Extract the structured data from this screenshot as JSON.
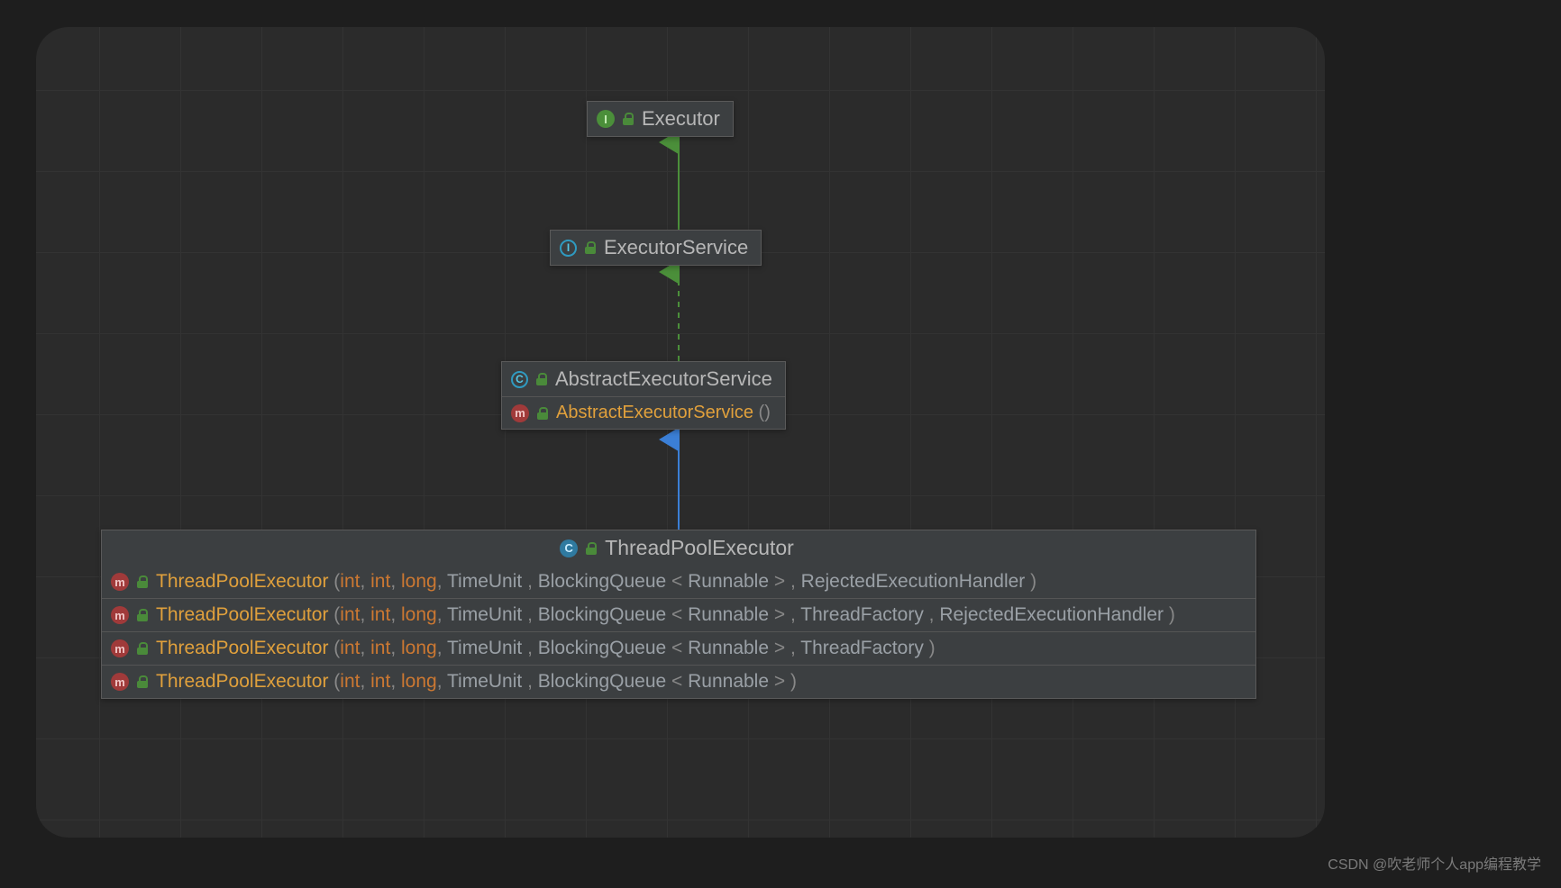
{
  "nodes": {
    "executor": {
      "kind": "interface",
      "label": "Executor"
    },
    "executorService": {
      "kind": "interface",
      "label": "ExecutorService"
    },
    "abstractExecSvc": {
      "kind": "abstractClass",
      "label": "AbstractExecutorService",
      "methods": [
        {
          "name": "AbstractExecutorService",
          "params": [],
          "trailing": "()"
        }
      ]
    },
    "threadPool": {
      "kind": "class",
      "label": "ThreadPoolExecutor",
      "methods": [
        {
          "name": "ThreadPoolExecutor",
          "primitives": [
            "int",
            "int",
            "long"
          ],
          "types": [
            "TimeUnit",
            "BlockingQueue",
            "RejectedExecutionHandler"
          ],
          "generics": [
            null,
            "Runnable",
            null
          ]
        },
        {
          "name": "ThreadPoolExecutor",
          "primitives": [
            "int",
            "int",
            "long"
          ],
          "types": [
            "TimeUnit",
            "BlockingQueue",
            "ThreadFactory",
            "RejectedExecutionHandler"
          ],
          "generics": [
            null,
            "Runnable",
            null,
            null
          ]
        },
        {
          "name": "ThreadPoolExecutor",
          "primitives": [
            "int",
            "int",
            "long"
          ],
          "types": [
            "TimeUnit",
            "BlockingQueue",
            "ThreadFactory"
          ],
          "generics": [
            null,
            "Runnable",
            null
          ]
        },
        {
          "name": "ThreadPoolExecutor",
          "primitives": [
            "int",
            "int",
            "long"
          ],
          "types": [
            "TimeUnit",
            "BlockingQueue"
          ],
          "generics": [
            null,
            "Runnable"
          ]
        }
      ]
    }
  },
  "edges": [
    {
      "from": "executorService",
      "to": "executor",
      "style": "implements"
    },
    {
      "from": "abstractExecSvc",
      "to": "executorService",
      "style": "implements-dashed"
    },
    {
      "from": "threadPool",
      "to": "abstractExecSvc",
      "style": "extends"
    }
  ],
  "watermark": "CSDN @吹老师个人app编程教学"
}
